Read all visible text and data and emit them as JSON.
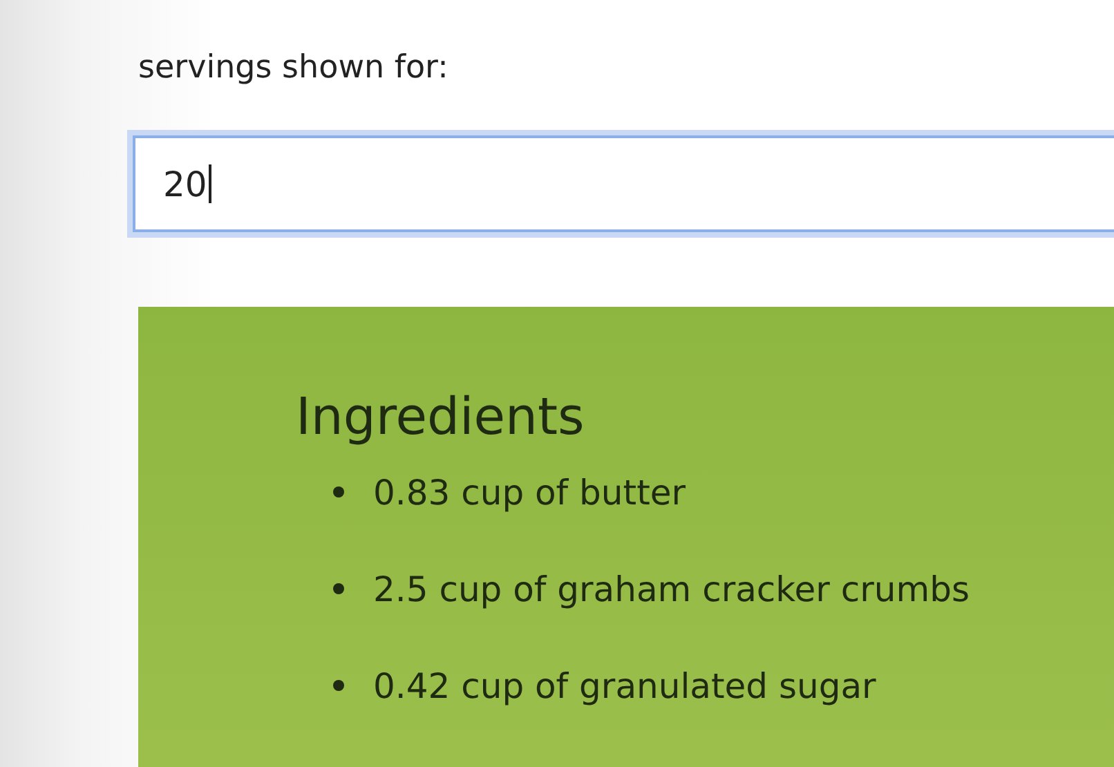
{
  "servings": {
    "label": "servings shown for:",
    "value": "20"
  },
  "ingredients": {
    "title": "Ingredients",
    "items": [
      {
        "text": "0.83 cup of butter"
      },
      {
        "text": "2.5 cup of graham cracker crumbs"
      },
      {
        "text": "0.42 cup of granulated sugar"
      }
    ]
  }
}
